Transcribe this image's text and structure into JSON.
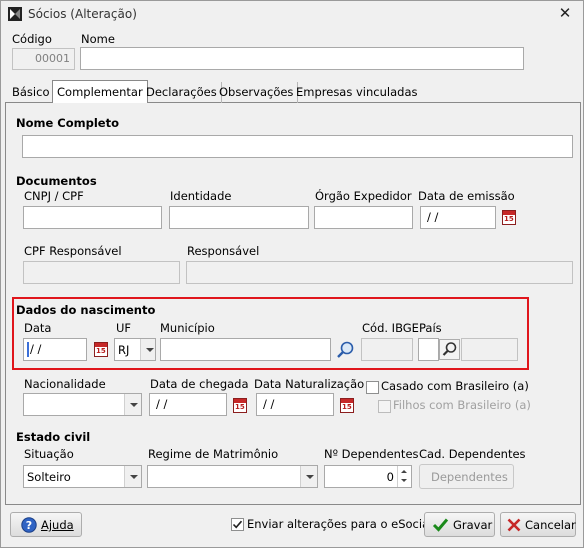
{
  "window": {
    "title": "Sócios (Alteração)"
  },
  "header": {
    "codigo_label": "Código",
    "codigo_value": "00001",
    "nome_label": "Nome",
    "nome_value": ""
  },
  "tabs": [
    {
      "label": "Básico",
      "active": false
    },
    {
      "label": "Complementar",
      "active": true
    },
    {
      "label": "Declarações",
      "active": false
    },
    {
      "label": "Observações",
      "active": false
    },
    {
      "label": "Empresas vinculadas",
      "active": false
    }
  ],
  "form": {
    "nome_completo_label": "Nome Completo",
    "documentos_label": "Documentos",
    "cnpj_label": "CNPJ / CPF",
    "identidade_label": "Identidade",
    "orgao_label": "Órgão Expedidor",
    "data_emissao_label": "Data de emissão",
    "data_emissao_value": " /  /",
    "cpf_resp_label": "CPF Responsável",
    "responsavel_label": "Responsável",
    "nascimento_label": "Dados do nascimento",
    "data_label": "Data",
    "data_value": " /  /",
    "uf_label": "UF",
    "uf_value": "RJ",
    "municipio_label": "Município",
    "cod_ibge_label": "Cód. IBGE",
    "pais_label": "País",
    "nacionalidade_label": "Nacionalidade",
    "data_chegada_label": "Data de chegada",
    "data_chegada_value": " /  /",
    "data_natural_label": "Data Naturalização",
    "data_natural_value": " /  /",
    "casado_label": "Casado com Brasileiro (a)",
    "filhos_label": "Filhos com Brasileiro (a)",
    "estado_civil_label": "Estado civil",
    "situacao_label": "Situação",
    "situacao_value": "Solteiro",
    "regime_label": "Regime de Matrimônio",
    "num_dep_label": "Nº Dependentes",
    "num_dep_value": "0",
    "cad_dep_label": "Cad. Dependentes",
    "dependentes_button": "Dependentes"
  },
  "footer": {
    "ajuda_button": "Ajuda",
    "enviar_label": "Enviar alterações para o eSocial",
    "enviar_checked": true,
    "gravar_button": "Gravar",
    "cancelar_button": "Cancelar"
  },
  "colors": {
    "highlight_border": "#e0161c",
    "accent_ok": "#1b8a1b",
    "accent_cancel": "#c62828"
  },
  "icons": [
    "app-icon",
    "close-icon",
    "calendar-icon",
    "search-icon",
    "help-icon",
    "check-icon",
    "cancel-icon"
  ]
}
